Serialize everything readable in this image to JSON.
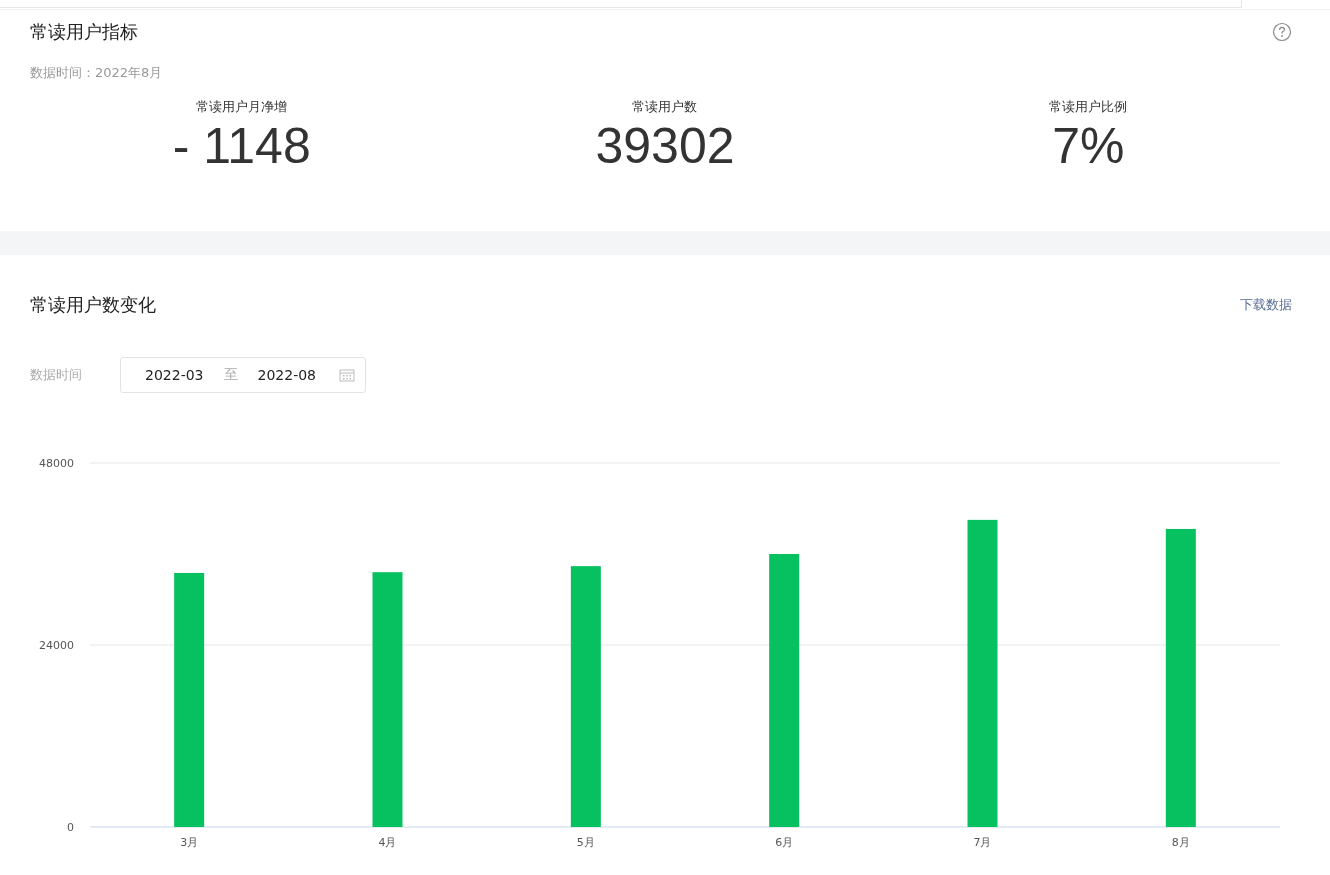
{
  "overview": {
    "title": "常读用户指标",
    "data_time": "数据时间：2022年8月",
    "metrics": [
      {
        "label": "常读用户月净增",
        "value": "- 1148"
      },
      {
        "label": "常读用户数",
        "value": "39302"
      },
      {
        "label": "常读用户比例",
        "value": "7%"
      }
    ]
  },
  "trend": {
    "title": "常读用户数变化",
    "download": "下载数据",
    "filter_label": "数据时间",
    "date_range": {
      "start": "2022-03",
      "separator": "至",
      "end": "2022-08"
    },
    "chart_data": {
      "type": "bar",
      "categories": [
        "3月",
        "4月",
        "5月",
        "6月",
        "7月",
        "8月"
      ],
      "series": [
        {
          "color": "#07c160",
          "values": [
            33500,
            33600,
            34400,
            36000,
            40500,
            39300
          ]
        }
      ],
      "ylim": [
        0,
        48000
      ],
      "yticks": [
        0,
        24000,
        48000
      ]
    }
  }
}
